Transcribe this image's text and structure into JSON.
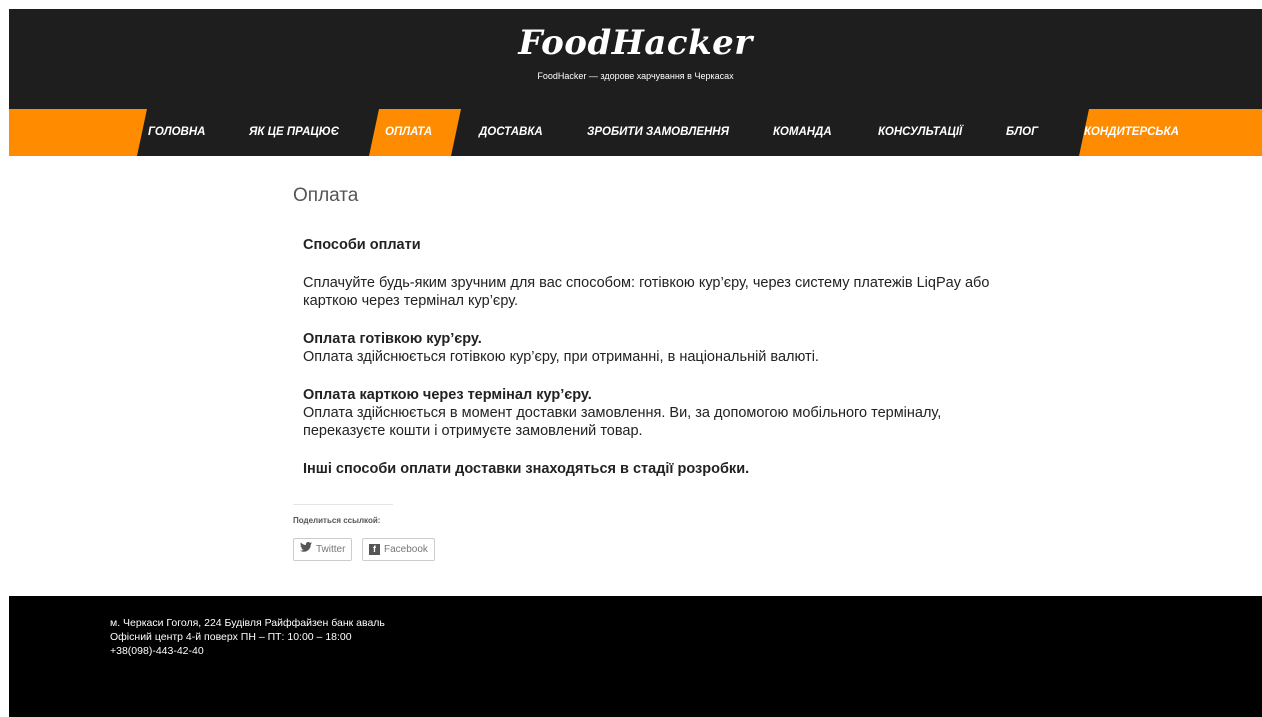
{
  "header": {
    "logo": "FoodHacker",
    "tagline": "FoodHacker — здорове харчування в Черкасах"
  },
  "nav": {
    "items": [
      {
        "label": "ГОЛОВНА"
      },
      {
        "label": "ЯК ЦЕ ПРАЦЮЄ"
      },
      {
        "label": "ОПЛАТА"
      },
      {
        "label": "ДОСТАВКА"
      },
      {
        "label": "ЗРОБИТИ ЗАМОВЛЕННЯ"
      },
      {
        "label": "КОМАНДА"
      },
      {
        "label": "КОНСУЛЬТАЦІЇ"
      },
      {
        "label": "БЛОГ"
      },
      {
        "label": "КОНДИТЕРСЬКА"
      }
    ],
    "active": "ОПЛАТА"
  },
  "main": {
    "title": "Оплата",
    "heading": "Способи оплати",
    "intro": "Сплачуйте будь-яким зручним для вас способом: готівкою кур’єру, через систему платежів LiqPay або карткою через термінал кур’єру.",
    "cash_heading": "Оплата готівкою кур’єру.",
    "cash_text": "Оплата здійснюється готівкою кур’єру, при отриманні, в національній валюті.",
    "card_heading": "Оплата карткою через термінал кур’єру.",
    "card_text": "Оплата здійснюється в момент доставки замовлення. Ви, за допомогою мобільного терміналу, переказуєте кошти і отримуєте замовлений товар.",
    "other": "Інші способи оплати доставки знаходяться в стадії розробки."
  },
  "share": {
    "label": "Поделиться ссылкой:",
    "twitter": "Twitter",
    "facebook": "Facebook"
  },
  "footer": {
    "address": "м. Черкаси Гоголя, 224 Будівля Райффайзен банк аваль Офісний центр 4-й поверх ПН – ПТ: 10:00 – 18:00 +38(098)-443-42-40"
  },
  "colors": {
    "accent": "#ff8c00",
    "header_bg": "#1e1e1e",
    "footer_bg": "#000000"
  }
}
